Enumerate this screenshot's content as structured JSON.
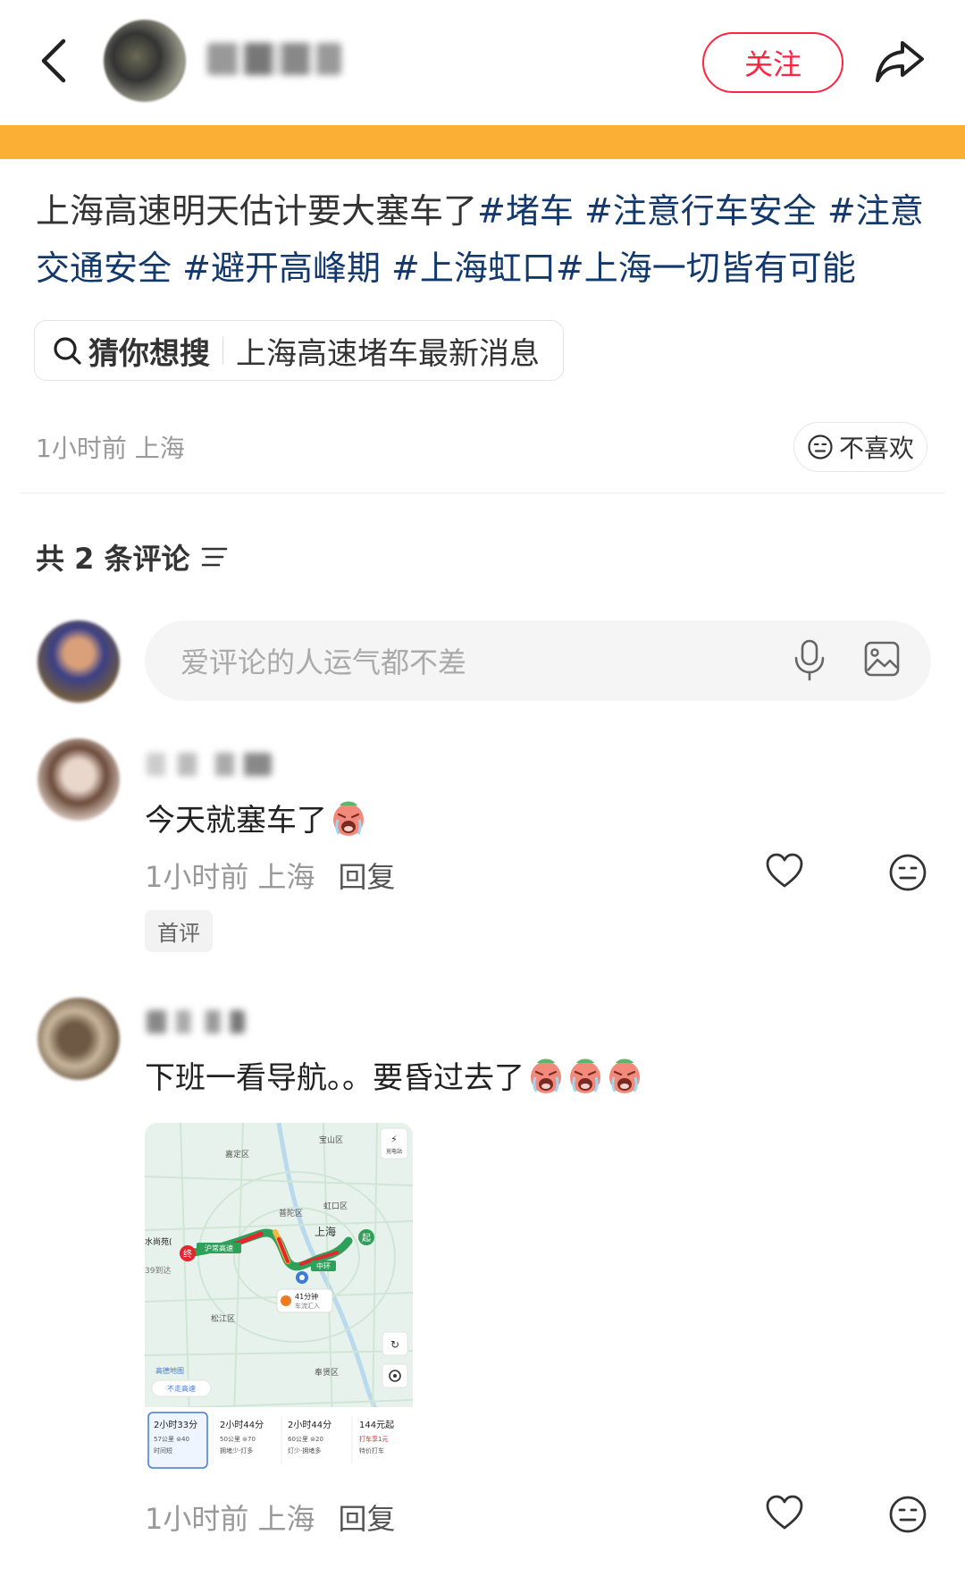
{
  "header": {
    "follow_label": "关注"
  },
  "post": {
    "text": "上海高速明天估计要大塞车了",
    "tags": [
      "#堵车",
      "#注意行车安全",
      "#注意交通安全",
      "#避开高峰期",
      "#上海虹口",
      "#上海一切皆有可能"
    ],
    "guess_prefix": "猜你想搜",
    "guess_query": "上海高速堵车最新消息",
    "meta": "1小时前 上海",
    "dislike_label": "不喜欢"
  },
  "comments_header": {
    "count_label": "共 2 条评论"
  },
  "comment_input": {
    "placeholder": "爱评论的人运气都不差"
  },
  "comments": [
    {
      "text": "今天就塞车了",
      "emoji_count": 1,
      "time": "1小时前 上海",
      "reply_label": "回复",
      "badge": "首评"
    },
    {
      "text": "下班一看导航。。要昏过去了",
      "emoji_count": 3,
      "time": "1小时前 上海",
      "reply_label": "回复",
      "map": {
        "districts": [
          "嘉定区",
          "宝山区",
          "虹口区",
          "普陀区",
          "上海",
          "松江区",
          "奉贤区",
          "水尚苑(",
          "39到达"
        ],
        "road_badges": [
          "沪常高速",
          "中环"
        ],
        "eta_bubble": "41分钟",
        "eta_sub": "车流汇入",
        "charging_label": "充电站",
        "avoid_highway": "不走高速",
        "logo_text": "高德地图",
        "route_options": [
          {
            "duration": "2小时33分",
            "line1": "57公里 ⊜40",
            "line2": "时间短"
          },
          {
            "duration": "2小时44分",
            "line1": "50公里 ⊜70",
            "line2": "拥堵少·灯多"
          },
          {
            "duration": "2小时44分",
            "line1": "60公里 ⊜20",
            "line2": "灯少·拥堵多"
          },
          {
            "duration": "144元起",
            "line1": "打车享1元",
            "line2": "特价打车"
          }
        ]
      }
    }
  ],
  "colors": {
    "accent_red": "#ff2442",
    "banner": "#fcaf35",
    "hashtag": "#13386c",
    "congestion_red": "#e5262e",
    "route_green": "#2fa05a"
  }
}
